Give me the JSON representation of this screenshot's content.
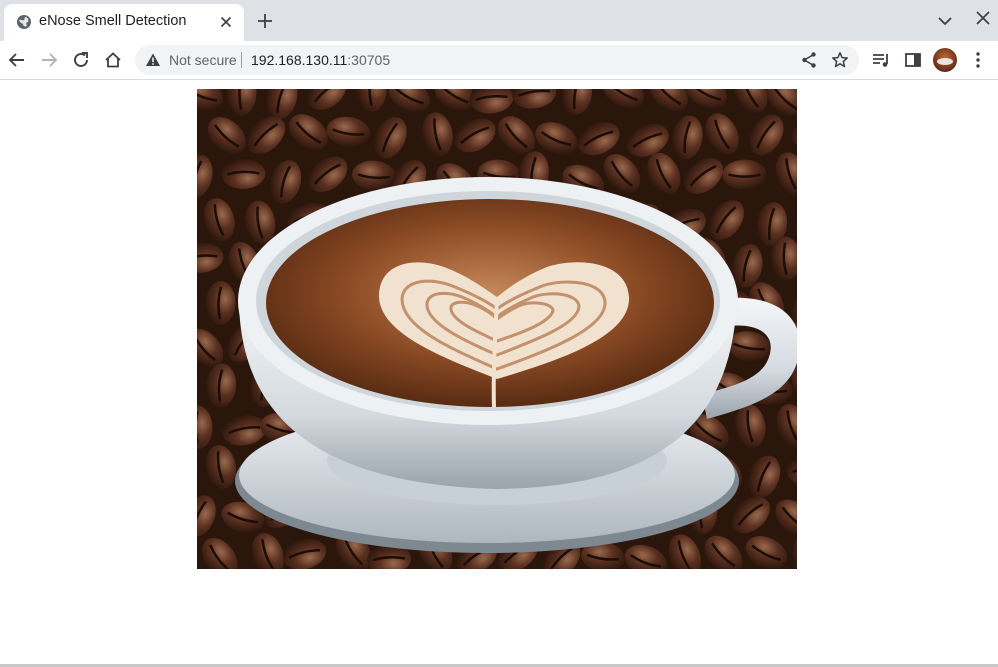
{
  "browser": {
    "tab": {
      "title": "eNose Smell Detection",
      "favicon": "globe-icon"
    },
    "address_bar": {
      "security_label": "Not secure",
      "url_host": "192.168.130.11",
      "url_port": ":30705"
    },
    "toolbar_icons": [
      "back-arrow-icon",
      "forward-arrow-icon",
      "reload-icon",
      "home-icon",
      "share-icon",
      "star-icon",
      "media-control-icon",
      "side-panel-icon",
      "profile-avatar",
      "kebab-menu-icon"
    ]
  },
  "page": {
    "image": {
      "subject": "latte-heart-coffee-cup",
      "colors": {
        "bean": "#4a2a1a",
        "foam": "#f3e6d6",
        "cup": "#e8ecef",
        "crema": "#8a4a24"
      }
    }
  }
}
